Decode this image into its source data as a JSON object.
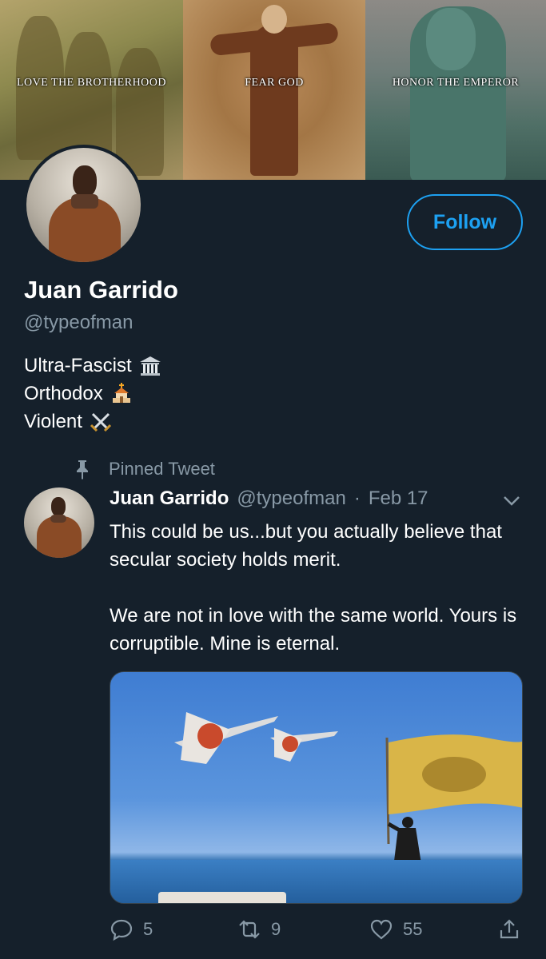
{
  "banner": {
    "captions": [
      "LOVE THE BROTHERHOOD",
      "FEAR GOD",
      "HONOR THE EMPEROR"
    ]
  },
  "profile": {
    "display_name": "Juan Garrido",
    "handle": "@typeofman",
    "follow_label": "Follow",
    "bio": [
      {
        "text": "Ultra-Fascist",
        "icon": "classical-building-icon"
      },
      {
        "text": "Orthodox",
        "icon": "church-icon"
      },
      {
        "text": "Violent",
        "icon": "crossed-swords-icon"
      }
    ]
  },
  "pinned_tweet": {
    "label": "Pinned Tweet",
    "author_name": "Juan Garrido",
    "author_handle": "@typeofman",
    "separator": "·",
    "date": "Feb 17",
    "text_paragraphs": [
      "This could be us...but you actually believe that secular society holds merit.",
      "We are not in love with the same world. Yours is corruptible. Mine is eternal."
    ],
    "stats": {
      "replies": "5",
      "retweets": "9",
      "likes": "55"
    }
  },
  "colors": {
    "background": "#15202b",
    "accent": "#1da1f2",
    "secondary_text": "#8899a6"
  }
}
